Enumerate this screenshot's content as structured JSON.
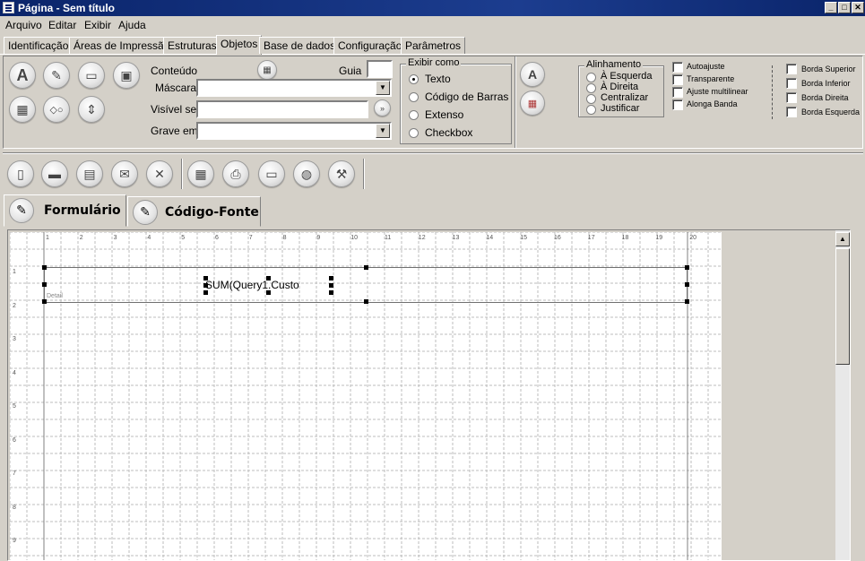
{
  "window": {
    "title": "Página - Sem título"
  },
  "menu": [
    "Arquivo",
    "Editar",
    "Exibir",
    "Ajuda"
  ],
  "tabs": [
    "Identificação",
    "Áreas de Impressão",
    "Estruturas",
    "Objetos",
    "Base de dados",
    "Configuração",
    "Parâmetros"
  ],
  "active_tab": "Objetos",
  "props": {
    "conteudo_label": "Conteúdo",
    "guia_label": "Guia",
    "guia_value": "",
    "mascara_label": "Máscara",
    "mascara_value": "",
    "visivel_label": "Visível se",
    "visivel_value": "",
    "grave_label": "Grave em",
    "grave_value": ""
  },
  "exibir_como": {
    "caption": "Exibir como",
    "options": [
      "Texto",
      "Código de Barras",
      "Extenso",
      "Checkbox"
    ],
    "selected": "Texto"
  },
  "alinhamento": {
    "caption": "Alinhamento",
    "options": [
      "À Esquerda",
      "À Direita",
      "Centralizar",
      "Justificar"
    ],
    "selected": ""
  },
  "flags": [
    "Autoajuste",
    "Transparente",
    "Ajuste multilinear",
    "Alonga Banda"
  ],
  "borders": [
    "Borda Superior",
    "Borda Inferior",
    "Borda Direita",
    "Borda Esquerda"
  ],
  "editor_tabs": [
    "Formulário",
    "Código-Fonte"
  ],
  "active_editor_tab": "Formulário",
  "ruler": {
    "top": [
      "1",
      "2",
      "3",
      "4",
      "5",
      "6",
      "7",
      "8",
      "9",
      "10",
      "11",
      "12",
      "13",
      "14",
      "15",
      "16",
      "17",
      "18",
      "19",
      "20"
    ],
    "left": [
      "1",
      "2",
      "3",
      "4",
      "5",
      "6",
      "7",
      "8",
      "9"
    ]
  },
  "band": {
    "label": "Detail"
  },
  "field": {
    "text": "SUM(Query1.Custo"
  },
  "colors": {
    "titlebar": "#0a246a",
    "face": "#d4d0c8",
    "grid": "#b0b0b0"
  },
  "icons": {
    "props": [
      "text-tool-icon",
      "pencil-icon",
      "monitor-icon",
      "image-icon",
      "calculator-icon",
      "shapes-icon",
      "updown-arrows-icon"
    ],
    "toolbar": [
      "new-file-icon",
      "open-folder-icon",
      "save-icon",
      "mail-icon",
      "delete-icon",
      "form-icon",
      "print-icon",
      "preview-monitor-icon",
      "globe-icon",
      "hammer-icon"
    ]
  }
}
